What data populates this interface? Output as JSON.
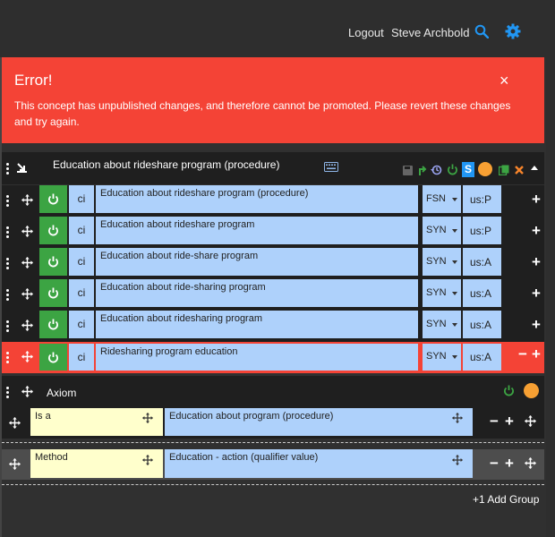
{
  "topbar": {
    "logout": "Logout",
    "user": "Steve Archbold",
    "accent": "#2196f3"
  },
  "error": {
    "title": "Error!",
    "close": "×",
    "message": "This concept has unpublished changes, and therefore cannot be promoted. Please revert these changes and try again.",
    "color": "#f44336"
  },
  "concept": {
    "title": "Education about rideshare program (procedure)",
    "status_badge": "S",
    "status_color": "#f7a033"
  },
  "descriptions": [
    {
      "case": "ci",
      "term": "Education about rideshare program (procedure)",
      "type": "FSN",
      "lang": "us:P"
    },
    {
      "case": "ci",
      "term": "Education about rideshare program",
      "type": "SYN",
      "lang": "us:P"
    },
    {
      "case": "ci",
      "term": "Education about ride-share program",
      "type": "SYN",
      "lang": "us:A"
    },
    {
      "case": "ci",
      "term": "Education about ride-sharing program",
      "type": "SYN",
      "lang": "us:A"
    },
    {
      "case": "ci",
      "term": "Education about ridesharing program",
      "type": "SYN",
      "lang": "us:A"
    },
    {
      "case": "ci",
      "term": "Ridesharing program education",
      "type": "SYN",
      "lang": "us:A"
    }
  ],
  "axiom": {
    "label": "Axiom",
    "relationships": [
      {
        "type": "Is a",
        "target": "Education about program (procedure)"
      },
      {
        "type": "Method",
        "target": "Education - action (qualifier value)"
      }
    ]
  },
  "footer": {
    "add_group": "+1 Add Group"
  }
}
